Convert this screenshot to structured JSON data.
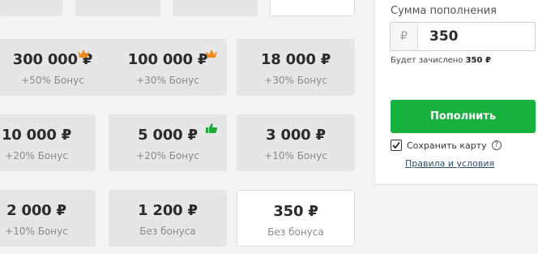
{
  "colors": {
    "accent_green": "#17b13e",
    "crown_orange": "#f08a1c",
    "thumb_green": "#1ea93a"
  },
  "tiles": [
    {
      "amount": "300 000 ₽",
      "bonus": "+50% Бонус",
      "badge": "crown-icon"
    },
    {
      "amount": "100 000 ₽",
      "bonus": "+30% Бонус",
      "badge": "crown-icon"
    },
    {
      "amount": "18 000 ₽",
      "bonus": "+30% Бонус"
    },
    {
      "amount": "10 000 ₽",
      "bonus": "+20% Бонус"
    },
    {
      "amount": "5 000 ₽",
      "bonus": "+20% Бонус",
      "badge": "thumbs-up-icon"
    },
    {
      "amount": "3 000 ₽",
      "bonus": "+10% Бонус"
    },
    {
      "amount": "2 000 ₽",
      "bonus": "+10% Бонус"
    },
    {
      "amount": "1 200 ₽",
      "bonus": "Без бонуса"
    },
    {
      "amount": "350 ₽",
      "bonus": "Без бонуса",
      "selected": true
    }
  ],
  "panel": {
    "label": "Сумма пополнения",
    "currency_symbol": "₽",
    "amount_value": "350",
    "credited_prefix": "Будет зачислено",
    "credited_value": "350 ₽",
    "topup_label": "Пополнить",
    "save_card_label": "Сохранить карту",
    "save_card_checked": true,
    "help_glyph": "?",
    "terms_label": "Правила и условия"
  }
}
